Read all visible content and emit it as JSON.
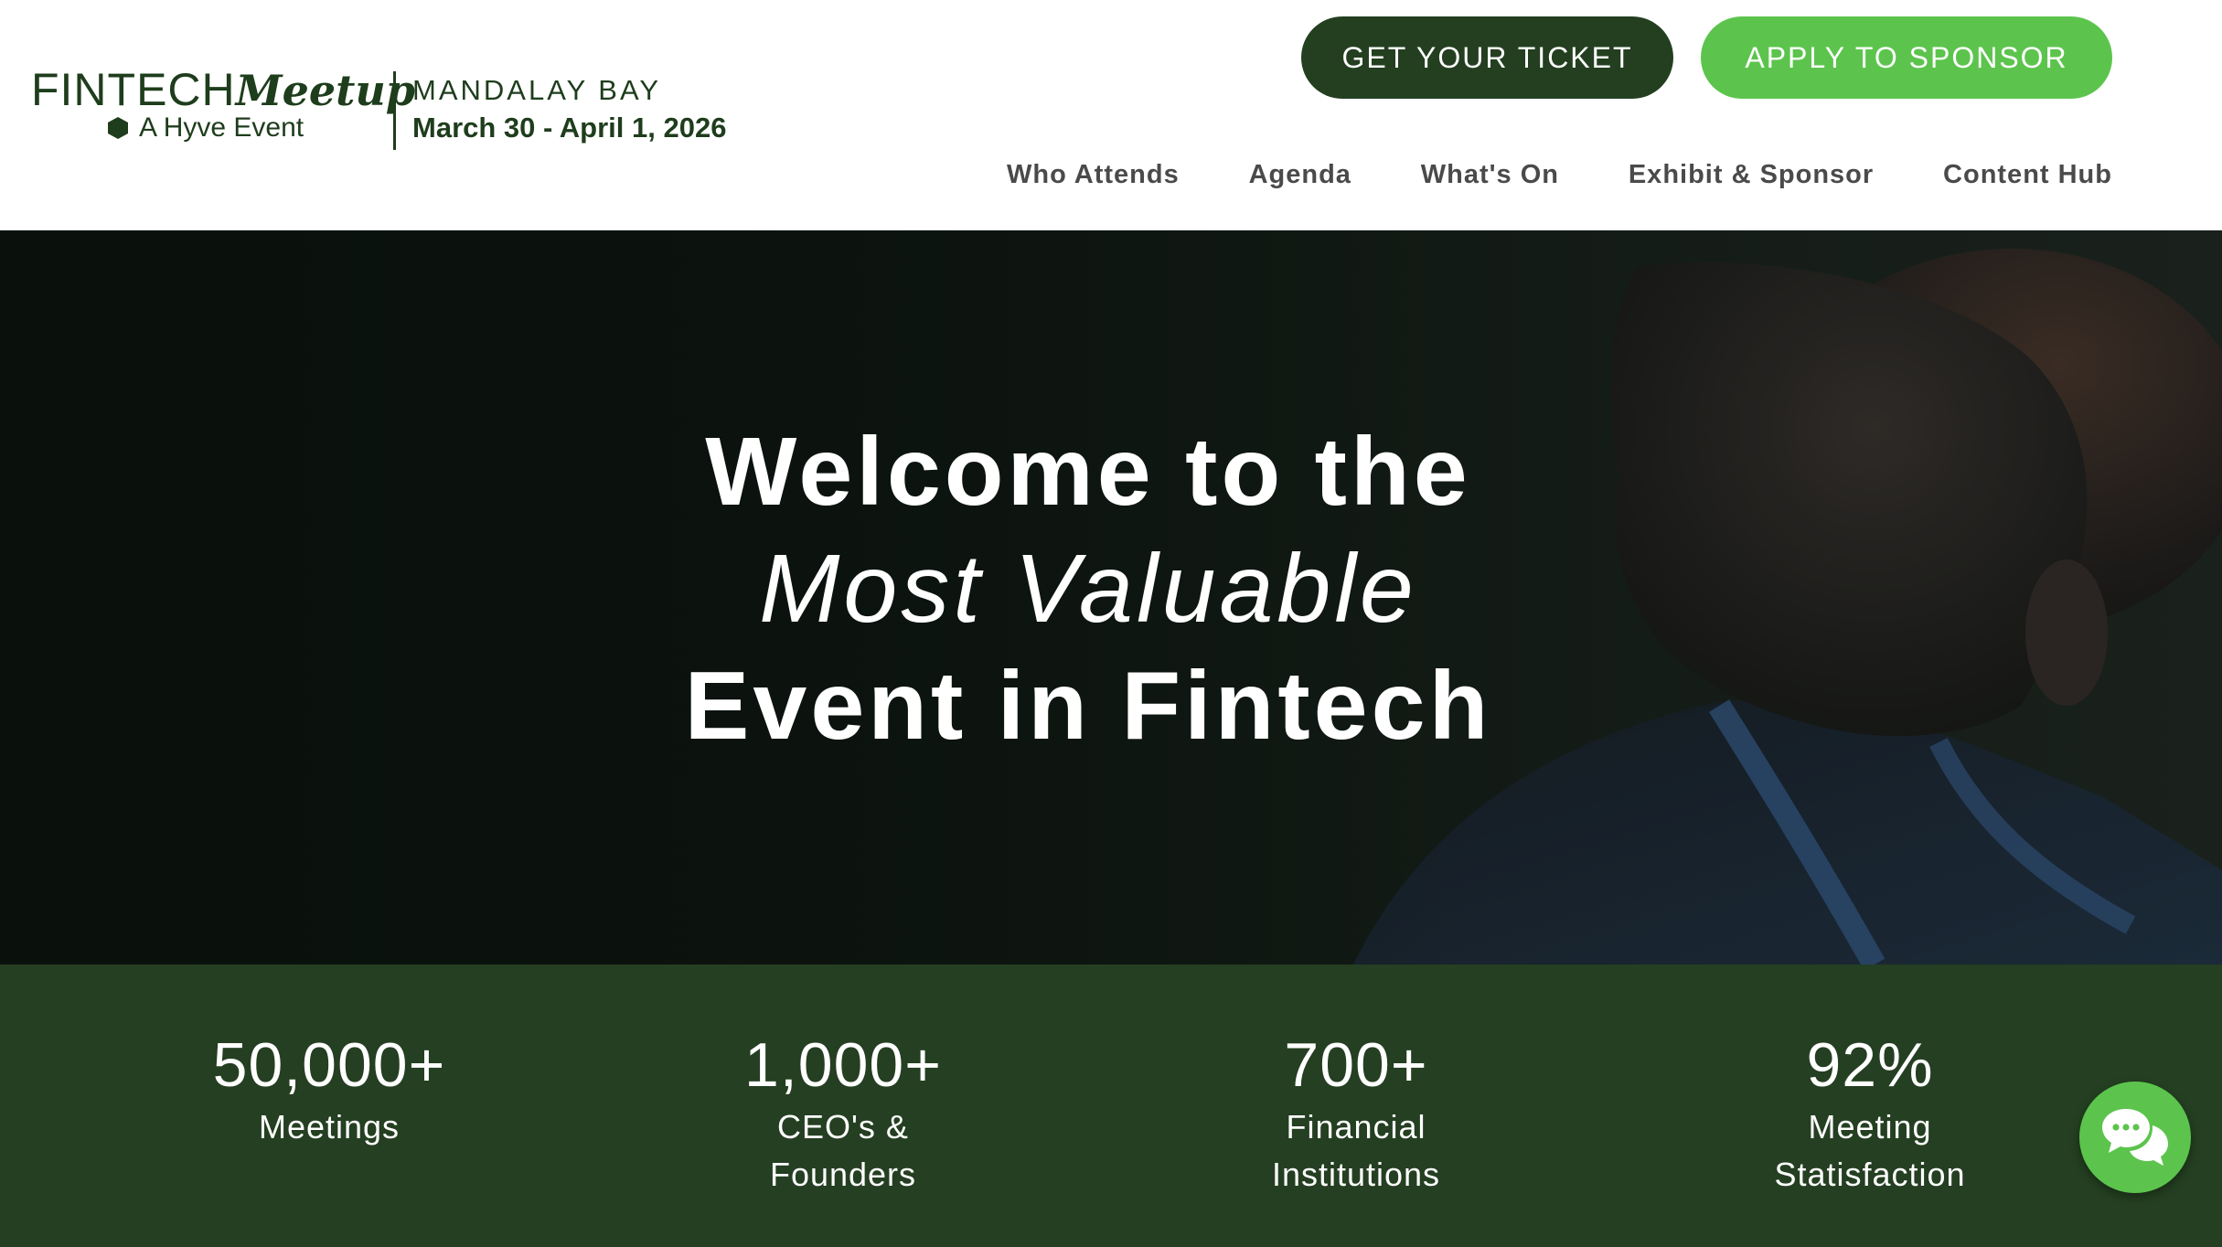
{
  "logo": {
    "brand_prefix": "FINTECH",
    "brand_suffix": "Meetup",
    "tagline": "A Hyve Event",
    "icon": "hexagon-icon"
  },
  "venue": {
    "name": "MANDALAY BAY",
    "dates": "March 30 - April 1, 2026"
  },
  "header_buttons": {
    "ticket": "GET YOUR TICKET",
    "sponsor": "APPLY TO SPONSOR"
  },
  "nav": {
    "items": [
      {
        "label": "Who Attends"
      },
      {
        "label": "Agenda"
      },
      {
        "label": "What's On"
      },
      {
        "label": "Exhibit & Sponsor"
      },
      {
        "label": "Content Hub"
      }
    ]
  },
  "hero": {
    "line1": "Welcome to the",
    "line2": "Most Valuable",
    "line3": "Event in Fintech"
  },
  "stats": [
    {
      "value": "50,000+",
      "label": "Meetings"
    },
    {
      "value": "1,000+",
      "label": "CEO's &\nFounders"
    },
    {
      "value": "700+",
      "label": "Financial\nInstitutions"
    },
    {
      "value": "92%",
      "label": "Meeting\nStatisfaction"
    }
  ],
  "chat": {
    "icon": "chat-bubbles-icon"
  },
  "colors": {
    "dark_green": "#233f20",
    "light_green": "#5cc44d",
    "stats_bg": "#243f21",
    "nav_text": "#4a4a4a"
  }
}
